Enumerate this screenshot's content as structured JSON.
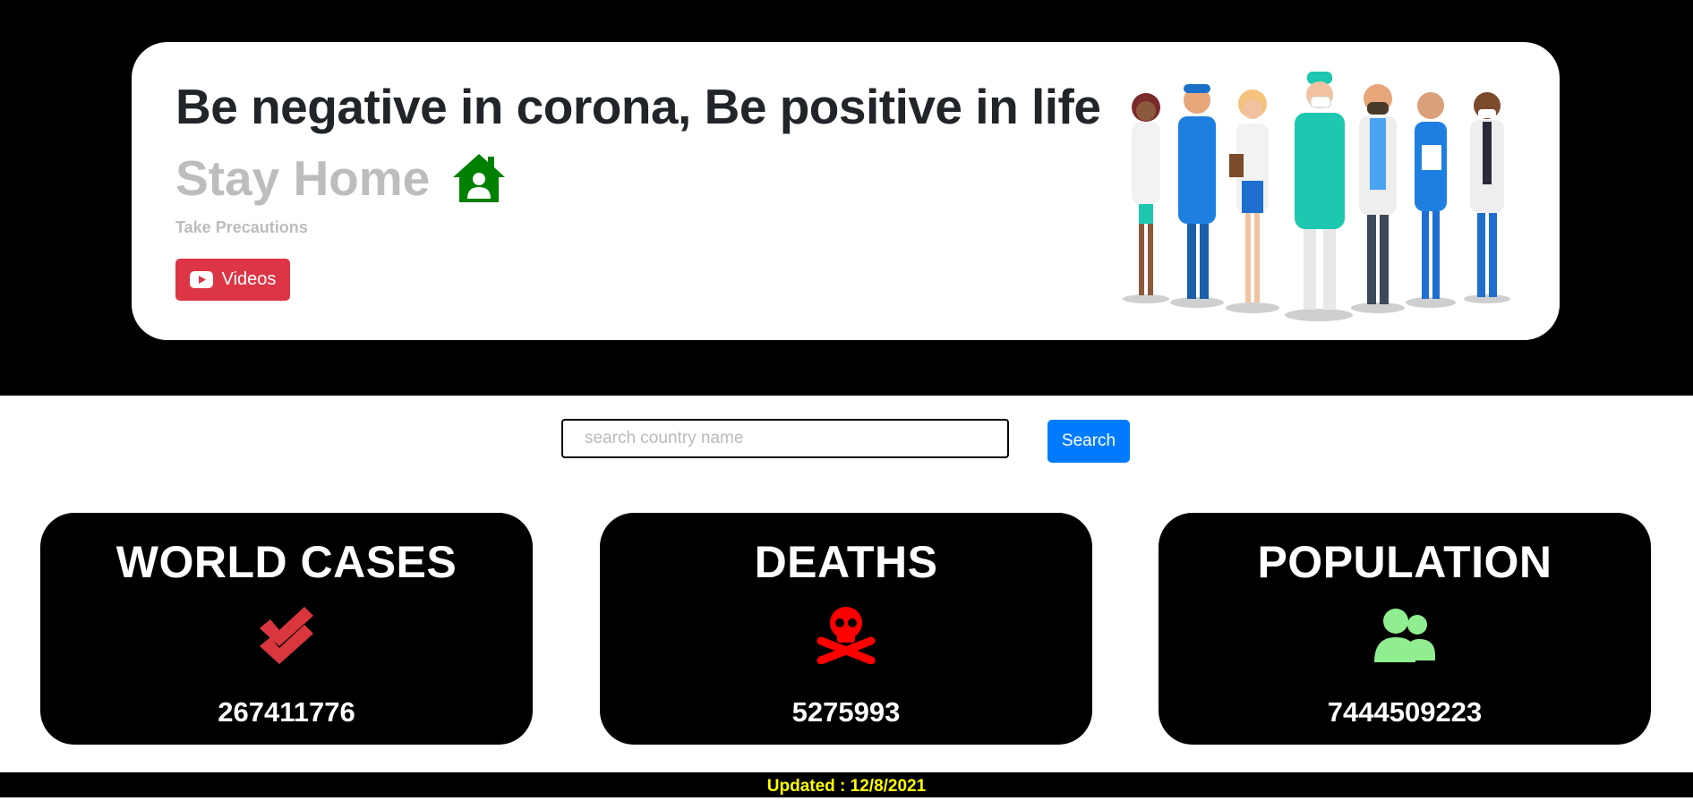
{
  "hero": {
    "headline": "Be negative in corona, Be positive in life",
    "subhead": "Stay Home",
    "subhead_icon": "house-user-icon",
    "tagline": "Take Precautions",
    "videos_button": "Videos",
    "videos_icon": "youtube-icon",
    "illustration": "healthcare-workers-illustration"
  },
  "search": {
    "placeholder": "search country name",
    "value": "",
    "button_label": "Search"
  },
  "stats": [
    {
      "title": "WORLD CASES",
      "icon": "double-check-icon",
      "icon_color": "#d9363e",
      "value": "267411776"
    },
    {
      "title": "DEATHS",
      "icon": "skull-crossbones-icon",
      "icon_color": "#ff0000",
      "value": "5275993"
    },
    {
      "title": "POPULATION",
      "icon": "users-icon",
      "icon_color": "#90ee90",
      "value": "7444509223"
    }
  ],
  "footer": {
    "updated": "Updated : 12/8/2021"
  },
  "colors": {
    "videos_button": "#dc3545",
    "search_button": "#007bff",
    "footer_text": "#ffff00",
    "stay_home_icon": "#008000"
  }
}
